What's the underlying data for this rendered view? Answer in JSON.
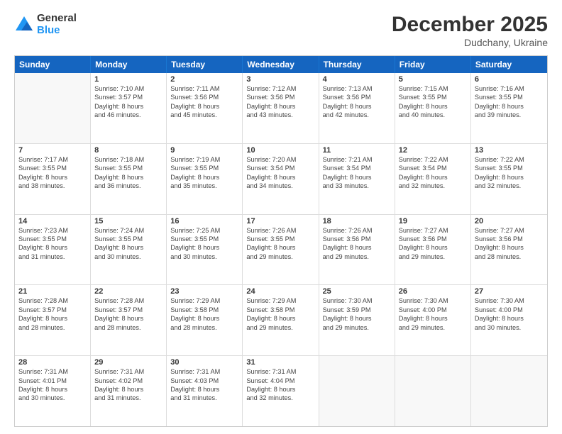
{
  "logo": {
    "general": "General",
    "blue": "Blue"
  },
  "header": {
    "month": "December 2025",
    "location": "Dudchany, Ukraine"
  },
  "days": [
    "Sunday",
    "Monday",
    "Tuesday",
    "Wednesday",
    "Thursday",
    "Friday",
    "Saturday"
  ],
  "weeks": [
    [
      {
        "day": "",
        "empty": true
      },
      {
        "day": "1",
        "sunrise": "7:10 AM",
        "sunset": "3:57 PM",
        "daylight": "8 hours and 46 minutes."
      },
      {
        "day": "2",
        "sunrise": "7:11 AM",
        "sunset": "3:56 PM",
        "daylight": "8 hours and 45 minutes."
      },
      {
        "day": "3",
        "sunrise": "7:12 AM",
        "sunset": "3:56 PM",
        "daylight": "8 hours and 43 minutes."
      },
      {
        "day": "4",
        "sunrise": "7:13 AM",
        "sunset": "3:56 PM",
        "daylight": "8 hours and 42 minutes."
      },
      {
        "day": "5",
        "sunrise": "7:15 AM",
        "sunset": "3:55 PM",
        "daylight": "8 hours and 40 minutes."
      },
      {
        "day": "6",
        "sunrise": "7:16 AM",
        "sunset": "3:55 PM",
        "daylight": "8 hours and 39 minutes."
      }
    ],
    [
      {
        "day": "7",
        "sunrise": "7:17 AM",
        "sunset": "3:55 PM",
        "daylight": "8 hours and 38 minutes."
      },
      {
        "day": "8",
        "sunrise": "7:18 AM",
        "sunset": "3:55 PM",
        "daylight": "8 hours and 36 minutes."
      },
      {
        "day": "9",
        "sunrise": "7:19 AM",
        "sunset": "3:55 PM",
        "daylight": "8 hours and 35 minutes."
      },
      {
        "day": "10",
        "sunrise": "7:20 AM",
        "sunset": "3:54 PM",
        "daylight": "8 hours and 34 minutes."
      },
      {
        "day": "11",
        "sunrise": "7:21 AM",
        "sunset": "3:54 PM",
        "daylight": "8 hours and 33 minutes."
      },
      {
        "day": "12",
        "sunrise": "7:22 AM",
        "sunset": "3:54 PM",
        "daylight": "8 hours and 32 minutes."
      },
      {
        "day": "13",
        "sunrise": "7:22 AM",
        "sunset": "3:55 PM",
        "daylight": "8 hours and 32 minutes."
      }
    ],
    [
      {
        "day": "14",
        "sunrise": "7:23 AM",
        "sunset": "3:55 PM",
        "daylight": "8 hours and 31 minutes."
      },
      {
        "day": "15",
        "sunrise": "7:24 AM",
        "sunset": "3:55 PM",
        "daylight": "8 hours and 30 minutes."
      },
      {
        "day": "16",
        "sunrise": "7:25 AM",
        "sunset": "3:55 PM",
        "daylight": "8 hours and 30 minutes."
      },
      {
        "day": "17",
        "sunrise": "7:26 AM",
        "sunset": "3:55 PM",
        "daylight": "8 hours and 29 minutes."
      },
      {
        "day": "18",
        "sunrise": "7:26 AM",
        "sunset": "3:56 PM",
        "daylight": "8 hours and 29 minutes."
      },
      {
        "day": "19",
        "sunrise": "7:27 AM",
        "sunset": "3:56 PM",
        "daylight": "8 hours and 29 minutes."
      },
      {
        "day": "20",
        "sunrise": "7:27 AM",
        "sunset": "3:56 PM",
        "daylight": "8 hours and 28 minutes."
      }
    ],
    [
      {
        "day": "21",
        "sunrise": "7:28 AM",
        "sunset": "3:57 PM",
        "daylight": "8 hours and 28 minutes."
      },
      {
        "day": "22",
        "sunrise": "7:28 AM",
        "sunset": "3:57 PM",
        "daylight": "8 hours and 28 minutes."
      },
      {
        "day": "23",
        "sunrise": "7:29 AM",
        "sunset": "3:58 PM",
        "daylight": "8 hours and 28 minutes."
      },
      {
        "day": "24",
        "sunrise": "7:29 AM",
        "sunset": "3:58 PM",
        "daylight": "8 hours and 29 minutes."
      },
      {
        "day": "25",
        "sunrise": "7:30 AM",
        "sunset": "3:59 PM",
        "daylight": "8 hours and 29 minutes."
      },
      {
        "day": "26",
        "sunrise": "7:30 AM",
        "sunset": "4:00 PM",
        "daylight": "8 hours and 29 minutes."
      },
      {
        "day": "27",
        "sunrise": "7:30 AM",
        "sunset": "4:00 PM",
        "daylight": "8 hours and 30 minutes."
      }
    ],
    [
      {
        "day": "28",
        "sunrise": "7:31 AM",
        "sunset": "4:01 PM",
        "daylight": "8 hours and 30 minutes."
      },
      {
        "day": "29",
        "sunrise": "7:31 AM",
        "sunset": "4:02 PM",
        "daylight": "8 hours and 31 minutes."
      },
      {
        "day": "30",
        "sunrise": "7:31 AM",
        "sunset": "4:03 PM",
        "daylight": "8 hours and 31 minutes."
      },
      {
        "day": "31",
        "sunrise": "7:31 AM",
        "sunset": "4:04 PM",
        "daylight": "8 hours and 32 minutes."
      },
      {
        "day": "",
        "empty": true
      },
      {
        "day": "",
        "empty": true
      },
      {
        "day": "",
        "empty": true
      }
    ]
  ]
}
